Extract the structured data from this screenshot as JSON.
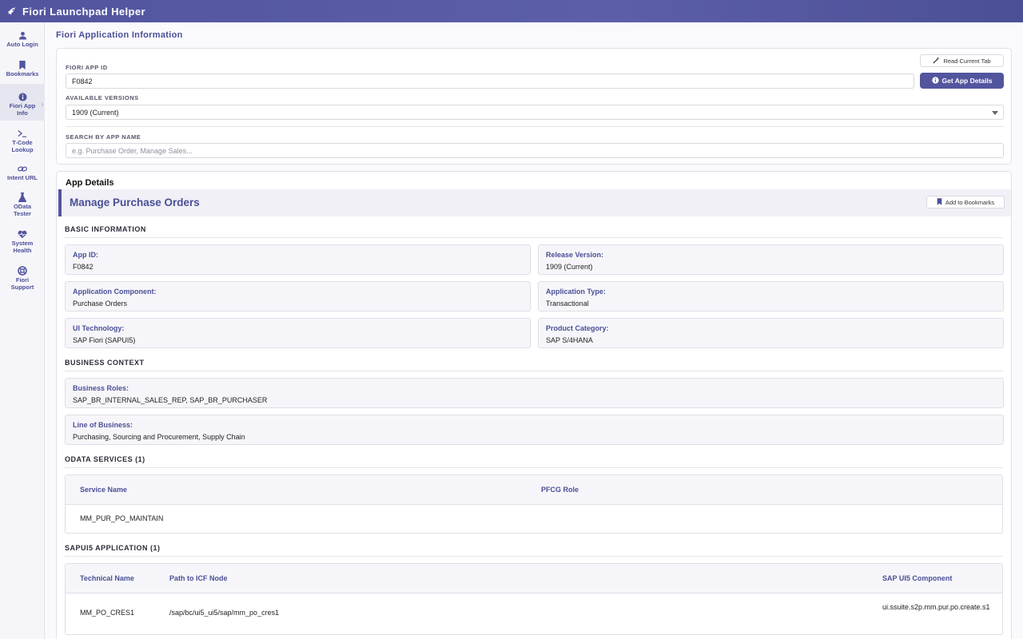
{
  "app": {
    "title": "Fiori Launchpad Helper"
  },
  "sidebar": {
    "items": [
      {
        "label": "Auto Login",
        "icon": "user-icon"
      },
      {
        "label": "Bookmarks",
        "icon": "bookmark-icon"
      },
      {
        "label": "Fiori App Info",
        "icon": "info-icon"
      },
      {
        "label": "T-Code Lookup",
        "icon": "terminal-icon"
      },
      {
        "label": "Intent URL",
        "icon": "link-icon"
      },
      {
        "label": "OData Tester",
        "icon": "flask-icon"
      },
      {
        "label": "System Health",
        "icon": "heart-pulse-icon"
      },
      {
        "label": "Fiori Support",
        "icon": "lifebuoy-icon"
      }
    ],
    "active_index": 2
  },
  "page": {
    "title": "Fiori Application Information"
  },
  "form": {
    "app_id_label": "FIORI APP ID",
    "app_id_value": "F0842",
    "read_tab_label": "Read Current Tab",
    "get_details_label": "Get App Details",
    "versions_label": "AVAILABLE VERSIONS",
    "version_selected": "1909 (Current)",
    "search_label": "SEARCH BY APP NAME",
    "search_placeholder": "e.g. Purchase Order, Manage Sales..."
  },
  "details": {
    "heading": "App Details",
    "app_name": "Manage Purchase Orders",
    "bookmark_label": "Add to Bookmarks",
    "basic_heading": "BASIC INFORMATION",
    "basic": [
      {
        "key": "App ID:",
        "value": "F0842"
      },
      {
        "key": "Release Version:",
        "value": "1909 (Current)"
      },
      {
        "key": "Application Component:",
        "value": "Purchase Orders"
      },
      {
        "key": "Application Type:",
        "value": "Transactional"
      },
      {
        "key": "UI Technology:",
        "value": "SAP Fiori (SAPUI5)"
      },
      {
        "key": "Product Category:",
        "value": "SAP S/4HANA"
      }
    ],
    "business_heading": "BUSINESS CONTEXT",
    "business": [
      {
        "key": "Business Roles:",
        "value": "SAP_BR_INTERNAL_SALES_REP, SAP_BR_PURCHASER"
      },
      {
        "key": "Line of Business:",
        "value": "Purchasing, Sourcing and Procurement, Supply Chain"
      }
    ],
    "odata_heading": "ODATA SERVICES (1)",
    "odata_columns": [
      "Service Name",
      "PFCG Role"
    ],
    "odata_rows": [
      [
        "MM_PUR_PO_MAINTAIN",
        ""
      ]
    ],
    "ui5_heading": "SAPUI5 APPLICATION (1)",
    "ui5_columns": [
      "Technical Name",
      "Path to ICF Node",
      "SAP UI5 Component"
    ],
    "ui5_rows": [
      [
        "MM_PO_CRES1",
        "/sap/bc/ui5_ui5/sap/mm_po_cres1",
        "ui.ssuite.s2p.mm.pur.po.create.s1"
      ]
    ]
  },
  "colors": {
    "primary": "#52559e",
    "accent_text": "#4b4f95",
    "background": "#fafafd"
  }
}
